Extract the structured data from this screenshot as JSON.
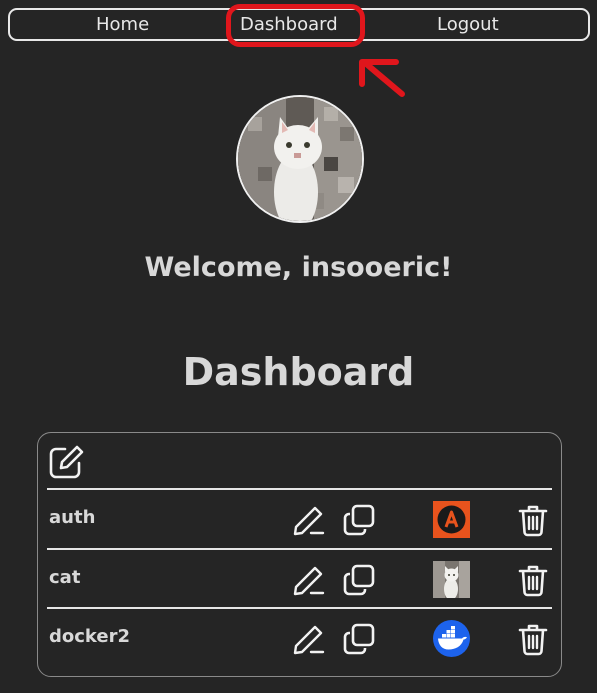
{
  "nav": {
    "items": [
      {
        "label": "Home"
      },
      {
        "label": "Dashboard"
      },
      {
        "label": "Logout"
      }
    ]
  },
  "profile": {
    "welcome": "Welcome, insooeric!"
  },
  "dashboard": {
    "title": "Dashboard",
    "new_icon": "edit-square-icon",
    "items": [
      {
        "name": "auth",
        "thumbnail": "auth-logo"
      },
      {
        "name": "cat",
        "thumbnail": "cat-photo"
      },
      {
        "name": "docker2",
        "thumbnail": "docker-logo"
      }
    ]
  },
  "colors": {
    "background": "#252525",
    "text": "#e6e6e6",
    "annotation": "#e0161c"
  }
}
